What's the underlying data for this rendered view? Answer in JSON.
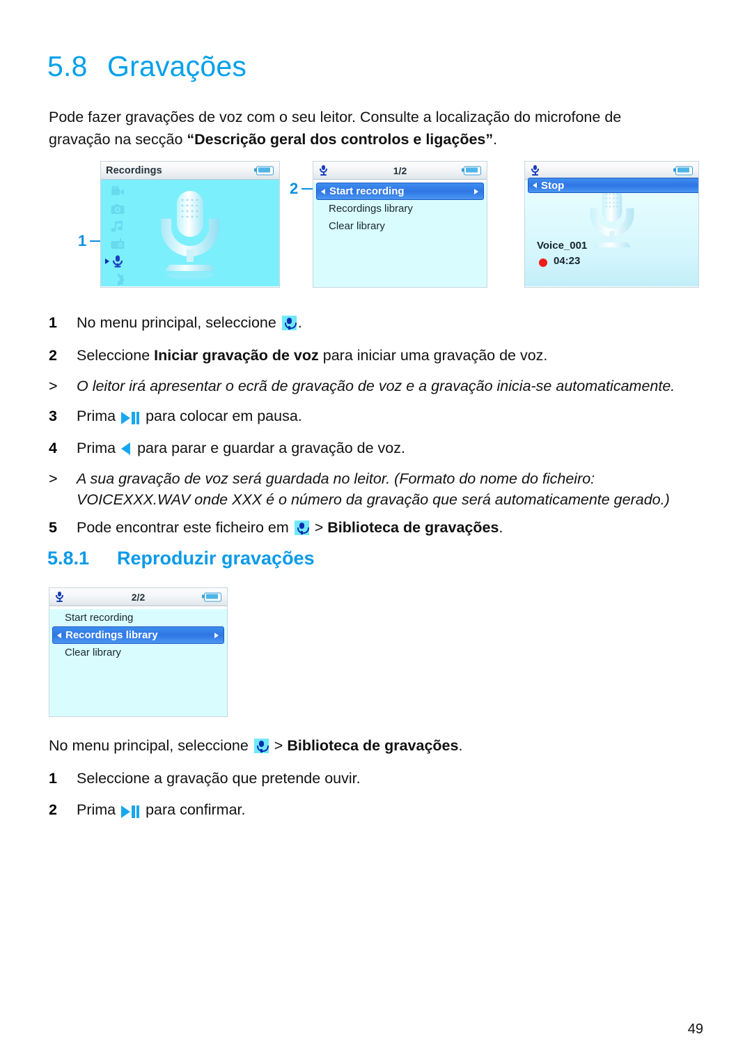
{
  "document": {
    "page_number": "49",
    "heading": {
      "number": "5.8",
      "title": "Gravações"
    },
    "subheading": {
      "number": "5.8.1",
      "title": "Reproduzir gravações"
    }
  },
  "intro": {
    "line1": "Pode fazer gravações de voz com o seu leitor. Consulte a localização do microfone de",
    "line2_prefix": "gravação na secção ",
    "line2_bold": "“Descrição geral dos controlos e ligações”",
    "line2_suffix": "."
  },
  "steps_primary": [
    {
      "marker": "1",
      "text_before": "No menu principal, seleccione ",
      "icon": "microphone-icon",
      "text_after": "."
    },
    {
      "marker": "2",
      "text_before": "Seleccione ",
      "bold": "Iniciar gravação de voz",
      "text_after": " para iniciar uma gravação de voz."
    },
    {
      "marker": ">",
      "italic": "O leitor irá apresentar o ecrã de gravação de voz e a gravação inicia-se automaticamente."
    },
    {
      "marker": "3",
      "text_before": "Prima ",
      "icon": "play-pause-icon",
      "text_after": " para colocar em pausa."
    },
    {
      "marker": "4",
      "text_before": "Prima ",
      "icon": "left-arrow-icon",
      "text_after": " para parar e guardar a gravação de voz."
    },
    {
      "marker": ">",
      "italic_line1": "A sua gravação de voz será guardada no leitor. (Formato do nome do ficheiro: VOICEXXX.WAV",
      "italic_line2": "onde XXX é o número da gravação que será automaticamente gerado.)"
    },
    {
      "marker": "5",
      "text_before": "Pode encontrar este ficheiro em ",
      "icon": "microphone-icon",
      "text_mid": " > ",
      "bold": "Biblioteca de gravações",
      "text_after": "."
    }
  ],
  "steps_secondary": {
    "intro": {
      "text_before": "No menu principal, seleccione ",
      "icon": "microphone-icon",
      "text_mid": " > ",
      "bold": "Biblioteca de gravações",
      "text_after": "."
    },
    "items": [
      {
        "marker": "1",
        "text": "Seleccione a gravação que pretende ouvir."
      },
      {
        "marker": "2",
        "text_before": "Prima ",
        "icon": "play-pause-icon",
        "text_after": " para confirmar."
      }
    ]
  },
  "callouts": [
    {
      "id": "callout-1",
      "label": "1"
    },
    {
      "id": "callout-2",
      "label": "2"
    }
  ],
  "screens": {
    "main_menu": {
      "title": "Recordings",
      "battery": "battery-icon",
      "sidebar_icons": [
        "video-camera-icon",
        "photo-camera-icon",
        "music-note-icon",
        "radio-icon",
        "microphone-icon",
        "settings-gear-icon",
        "play-circle-icon"
      ],
      "selected_index": 4,
      "artwork": "microphone-illustration"
    },
    "recordings_menu_1": {
      "title_icon": "microphone-icon",
      "page_indicator": "1/2",
      "battery": "battery-icon",
      "items": [
        {
          "label": "Start recording",
          "selected": true
        },
        {
          "label": "Recordings library",
          "selected": false
        },
        {
          "label": "Clear library",
          "selected": false
        }
      ]
    },
    "recording_screen": {
      "title_icon": "microphone-icon",
      "battery": "battery-icon",
      "artwork": "microphone-illustration",
      "filename": "Voice_001",
      "elapsed": "04:23",
      "record_indicator": "record-dot-icon",
      "action_label": "Stop"
    },
    "recordings_menu_2": {
      "title_icon": "microphone-icon",
      "page_indicator": "2/2",
      "battery": "battery-icon",
      "items": [
        {
          "label": "Start recording",
          "selected": false
        },
        {
          "label": "Recordings library",
          "selected": true
        },
        {
          "label": "Clear library",
          "selected": false
        }
      ]
    }
  },
  "colors": {
    "heading_blue": "#00a0e9",
    "subheading_blue": "#0a9ae8",
    "screen_cyan": "#7ceffc",
    "menu_cyan": "#d9fdff",
    "highlight_blue": "#2f76e4",
    "record_red": "#ef1c1c",
    "icon_blue": "#1b3fc0",
    "callout_blue": "#0b8fe0"
  }
}
